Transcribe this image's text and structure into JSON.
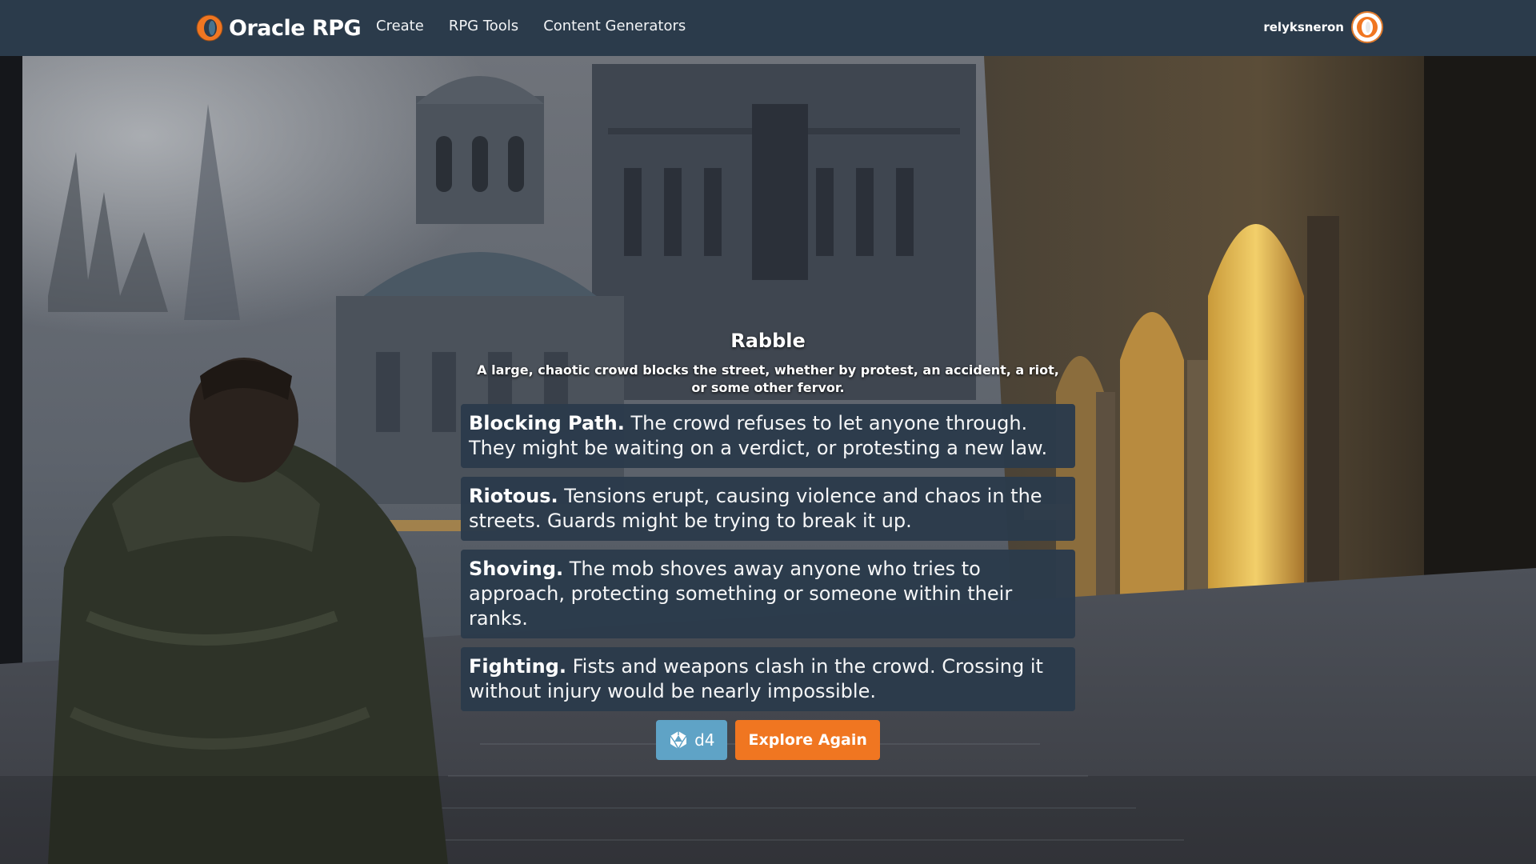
{
  "brand": {
    "name": "Oracle RPG"
  },
  "nav": {
    "links": [
      "Create",
      "RPG Tools",
      "Content Generators"
    ]
  },
  "user": {
    "name": "relyksneron"
  },
  "encounter": {
    "title": "Rabble",
    "description": "A large, chaotic crowd blocks the street, whether by protest, an accident, a riot, or some other fervor.",
    "options": [
      {
        "name": "Blocking Path.",
        "text": " The crowd refuses to let anyone through. They might be waiting on a verdict, or protesting a new law."
      },
      {
        "name": "Riotous.",
        "text": " Tensions erupt, causing violence and chaos in the streets. Guards might be trying to break it up."
      },
      {
        "name": "Shoving.",
        "text": " The mob shoves away anyone who tries to approach, protecting something or someone within their ranks."
      },
      {
        "name": "Fighting.",
        "text": " Fists and weapons clash in the crowd. Crossing it without injury would be nearly impossible."
      }
    ]
  },
  "actions": {
    "dice_label": "d4",
    "explore_label": "Explore Again"
  },
  "colors": {
    "navbar": "#2b3b4b",
    "accent": "#f07621",
    "dice_button": "#5fa3c6",
    "card": "#2b3b4b"
  },
  "icons": {
    "logo": "oracle-ring-icon",
    "dice": "d20-dice-icon"
  }
}
